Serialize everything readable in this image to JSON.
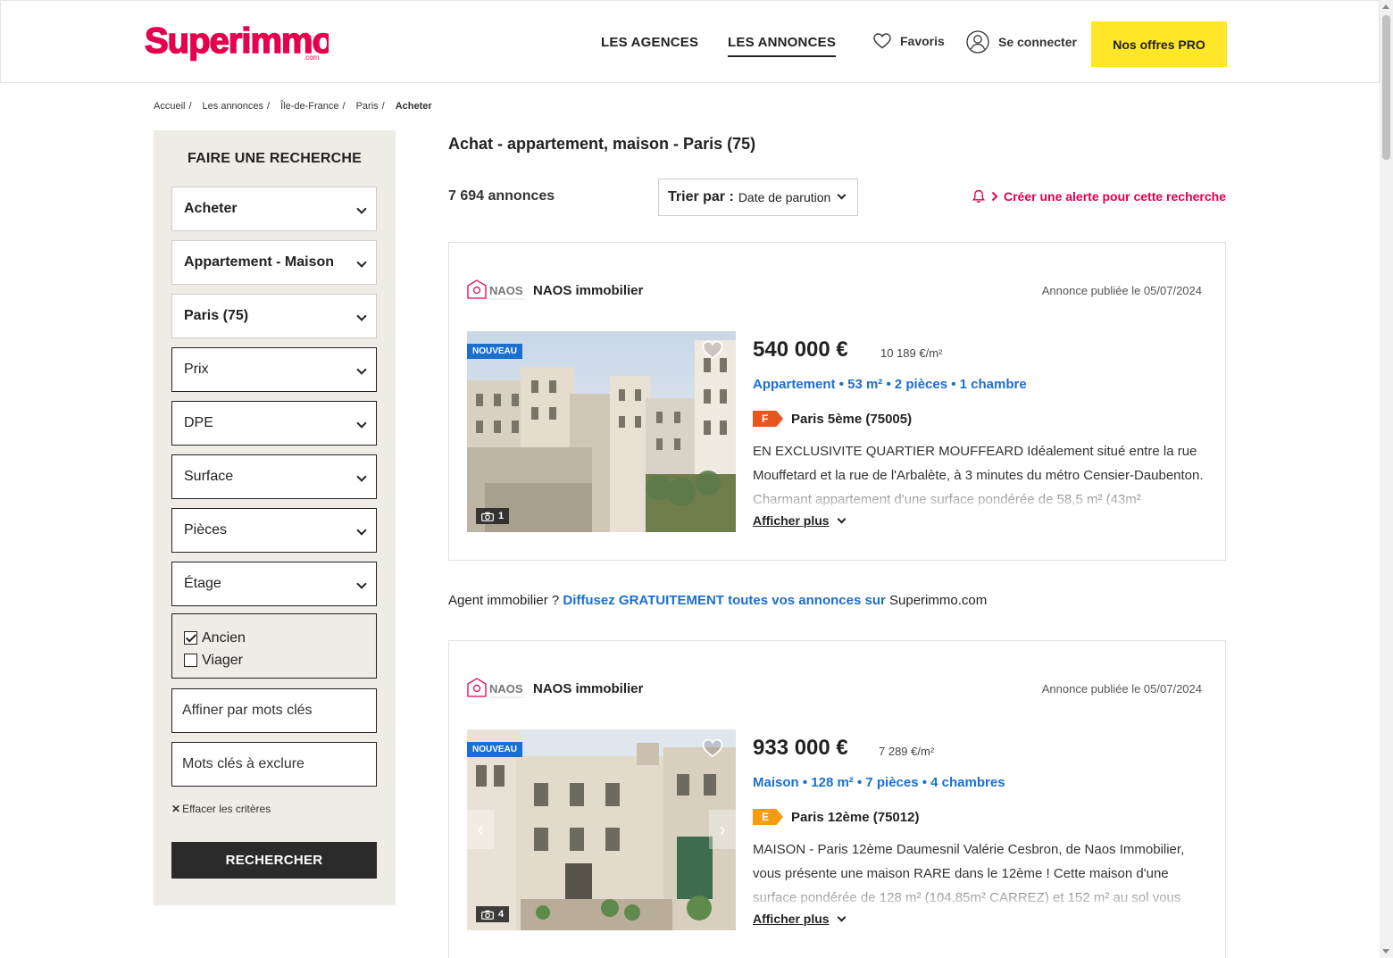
{
  "header": {
    "logo_text": "Superimmo",
    "logo_sub": ".com",
    "nav": [
      "LES AGENCES",
      "LES ANNONCES"
    ],
    "favorites": "Favoris",
    "login": "Se connecter",
    "pro_button": "Nos offres PRO"
  },
  "breadcrumb": [
    "Accueil",
    "Les annonces",
    "Île-de-France",
    "Paris",
    "Acheter"
  ],
  "sidebar": {
    "title": "FAIRE UNE RECHERCHE",
    "transaction": "Acheter",
    "property_type": "Appartement - Maison",
    "location": "Paris (75)",
    "filters": [
      "Prix",
      "DPE",
      "Surface",
      "Pièces",
      "Étage"
    ],
    "checkboxes": [
      {
        "label": "Ancien",
        "checked": true
      },
      {
        "label": "Viager",
        "checked": false
      }
    ],
    "keywords_placeholder": "Affiner par mots clés",
    "exclude_placeholder": "Mots clés à exclure",
    "clear_label": "Effacer les critères",
    "search_button": "RECHERCHER"
  },
  "main": {
    "title": "Achat - appartement, maison - Paris (75)",
    "count": "7 694 annonces",
    "sort_label": "Trier par :",
    "sort_value": "Date de parution",
    "alert_label": "Créer une alerte pour cette recherche"
  },
  "listings": [
    {
      "agency": "NAOS immobilier",
      "agency_logo_text": "NAOS",
      "published": "Annonce publiée le 05/07/2024",
      "badge": "NOUVEAU",
      "photo_count": "1",
      "price": "540 000 €",
      "price_per_m2": "10 189 €/m²",
      "features": "Appartement • 53 m² • 2 pièces • 1 chambre",
      "dpe": "F",
      "dpe_color": "#e8561f",
      "location": "Paris 5ème (75005)",
      "description": "EN EXCLUSIVITE QUARTIER MOUFFEARD Idéalement situé entre la rue Mouffetard et la rue de l'Arbalète, à 3 minutes du métro Censier-Daubenton. Charmant appartement d'une surface pondérée de 58,5 m² (43m²",
      "more": "Afficher plus"
    },
    {
      "agency": "NAOS immobilier",
      "agency_logo_text": "NAOS",
      "published": "Annonce publiée le 05/07/2024",
      "badge": "NOUVEAU",
      "photo_count": "4",
      "price": "933 000 €",
      "price_per_m2": "7 289 €/m²",
      "features": "Maison • 128 m² • 7 pièces • 4 chambres",
      "dpe": "E",
      "dpe_color": "#f39c12",
      "location": "Paris 12ème (75012)",
      "description": "MAISON - Paris 12ème Daumesnil Valérie Cesbron, de Naos Immobilier, vous présente une maison RARE dans le 12ème ! Cette maison d'une surface pondérée de 128 m² (104,85m² CARREZ) et 152 m² au sol vous",
      "more": "Afficher plus"
    }
  ],
  "promo": {
    "prefix": "Agent immobilier ?",
    "link": "Diffusez GRATUITEMENT toutes vos annonces sur",
    "suffix": "Superimmo.com"
  },
  "colors": {
    "brand": "#e4004b",
    "pro_button": "#ffe628",
    "link_blue": "#1a6fd1",
    "sidebar_bg": "#efebe7"
  }
}
